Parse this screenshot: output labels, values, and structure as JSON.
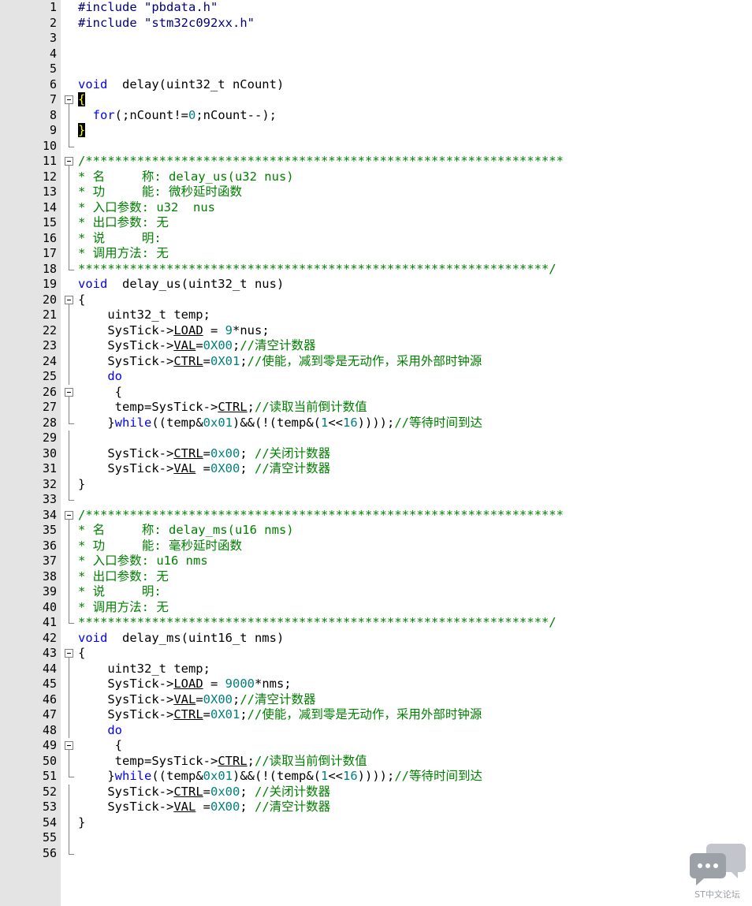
{
  "editor": {
    "lines": [
      {
        "n": "1",
        "fold": "",
        "t": [
          [
            "pp",
            "#include "
          ],
          [
            "str",
            "\"pbdata.h\""
          ]
        ]
      },
      {
        "n": "2",
        "fold": "",
        "t": [
          [
            "pp",
            "#include "
          ],
          [
            "str",
            "\"stm32c092xx.h\""
          ]
        ]
      },
      {
        "n": "3",
        "fold": "",
        "t": []
      },
      {
        "n": "4",
        "fold": "",
        "t": []
      },
      {
        "n": "5",
        "fold": "",
        "t": []
      },
      {
        "n": "6",
        "fold": "",
        "t": [
          [
            "kw",
            "void"
          ],
          [
            "",
            "  delay(uint32_t nCount)"
          ]
        ]
      },
      {
        "n": "7",
        "fold": "box",
        "t": [
          [
            "hl",
            "{"
          ]
        ]
      },
      {
        "n": "8",
        "fold": "line",
        "t": [
          [
            "",
            "  "
          ],
          [
            "kw",
            "for"
          ],
          [
            "",
            "(;nCount!="
          ],
          [
            "num",
            "0"
          ],
          [
            "",
            ";nCount--);"
          ]
        ]
      },
      {
        "n": "9",
        "fold": "line",
        "t": [
          [
            "hl",
            "}"
          ]
        ]
      },
      {
        "n": "10",
        "fold": "end",
        "t": []
      },
      {
        "n": "11",
        "fold": "box",
        "t": [
          [
            "cm",
            "/*****************************************************************"
          ]
        ]
      },
      {
        "n": "12",
        "fold": "line",
        "t": [
          [
            "cm",
            "* 名     称: delay_us(u32 nus)"
          ]
        ]
      },
      {
        "n": "13",
        "fold": "line",
        "t": [
          [
            "cm",
            "* 功     能: 微秒延时函数"
          ]
        ]
      },
      {
        "n": "14",
        "fold": "line",
        "t": [
          [
            "cm",
            "* 入口参数: u32  nus"
          ]
        ]
      },
      {
        "n": "15",
        "fold": "line",
        "t": [
          [
            "cm",
            "* 出口参数: 无"
          ]
        ]
      },
      {
        "n": "16",
        "fold": "line",
        "t": [
          [
            "cm",
            "* 说     明:"
          ]
        ]
      },
      {
        "n": "17",
        "fold": "line",
        "t": [
          [
            "cm",
            "* 调用方法: 无"
          ]
        ]
      },
      {
        "n": "18",
        "fold": "end",
        "t": [
          [
            "cm",
            "****************************************************************/"
          ]
        ]
      },
      {
        "n": "19",
        "fold": "",
        "t": [
          [
            "kw",
            "void"
          ],
          [
            "",
            "  delay_us(uint32_t nus)"
          ]
        ]
      },
      {
        "n": "20",
        "fold": "box",
        "t": [
          [
            "",
            "{"
          ]
        ]
      },
      {
        "n": "21",
        "fold": "line",
        "t": [
          [
            "",
            "    uint32_t temp;"
          ]
        ]
      },
      {
        "n": "22",
        "fold": "line",
        "t": [
          [
            "",
            "    SysTick->"
          ],
          [
            "u",
            "LOAD"
          ],
          [
            "",
            " = "
          ],
          [
            "num",
            "9"
          ],
          [
            "",
            "*nus;"
          ]
        ]
      },
      {
        "n": "23",
        "fold": "line",
        "t": [
          [
            "",
            "    SysTick->"
          ],
          [
            "u",
            "VAL"
          ],
          [
            "",
            "="
          ],
          [
            "num",
            "0X00"
          ],
          [
            "",
            ";"
          ],
          [
            "cm",
            "//清空计数器"
          ]
        ]
      },
      {
        "n": "24",
        "fold": "line",
        "t": [
          [
            "",
            "    SysTick->"
          ],
          [
            "u",
            "CTRL"
          ],
          [
            "",
            "="
          ],
          [
            "num",
            "0X01"
          ],
          [
            "",
            ";"
          ],
          [
            "cm",
            "//使能，减到零是无动作，采用外部时钟源"
          ]
        ]
      },
      {
        "n": "25",
        "fold": "line",
        "t": [
          [
            "",
            "    "
          ],
          [
            "kw",
            "do"
          ]
        ]
      },
      {
        "n": "26",
        "fold": "box",
        "t": [
          [
            "",
            "     {"
          ]
        ]
      },
      {
        "n": "27",
        "fold": "line",
        "t": [
          [
            "",
            "     temp=SysTick->"
          ],
          [
            "u",
            "CTRL"
          ],
          [
            "",
            ";"
          ],
          [
            "cm",
            "//读取当前倒计数值"
          ]
        ]
      },
      {
        "n": "28",
        "fold": "end",
        "t": [
          [
            "",
            "    }"
          ],
          [
            "kw",
            "while"
          ],
          [
            "",
            "((temp&"
          ],
          [
            "num",
            "0x01"
          ],
          [
            "",
            ")&&(!(temp&("
          ],
          [
            "num",
            "1"
          ],
          [
            "",
            "<<"
          ],
          [
            "num",
            "16"
          ],
          [
            "",
            "))));"
          ],
          [
            "cm",
            "//等待时间到达"
          ]
        ]
      },
      {
        "n": "29",
        "fold": "line",
        "t": []
      },
      {
        "n": "30",
        "fold": "line",
        "t": [
          [
            "",
            "    SysTick->"
          ],
          [
            "u",
            "CTRL"
          ],
          [
            "",
            "="
          ],
          [
            "num",
            "0x00"
          ],
          [
            "",
            "; "
          ],
          [
            "cm",
            "//关闭计数器"
          ]
        ]
      },
      {
        "n": "31",
        "fold": "line",
        "t": [
          [
            "",
            "    SysTick->"
          ],
          [
            "u",
            "VAL"
          ],
          [
            "",
            " ="
          ],
          [
            "num",
            "0X00"
          ],
          [
            "",
            "; "
          ],
          [
            "cm",
            "//清空计数器"
          ]
        ]
      },
      {
        "n": "32",
        "fold": "line",
        "t": [
          [
            "",
            "}"
          ]
        ]
      },
      {
        "n": "33",
        "fold": "end",
        "t": []
      },
      {
        "n": "34",
        "fold": "box",
        "t": [
          [
            "cm",
            "/*****************************************************************"
          ]
        ]
      },
      {
        "n": "35",
        "fold": "line",
        "t": [
          [
            "cm",
            "* 名     称: delay_ms(u16 nms)"
          ]
        ]
      },
      {
        "n": "36",
        "fold": "line",
        "t": [
          [
            "cm",
            "* 功     能: 毫秒延时函数"
          ]
        ]
      },
      {
        "n": "37",
        "fold": "line",
        "t": [
          [
            "cm",
            "* 入口参数: u16 nms"
          ]
        ]
      },
      {
        "n": "38",
        "fold": "line",
        "t": [
          [
            "cm",
            "* 出口参数: 无"
          ]
        ]
      },
      {
        "n": "39",
        "fold": "line",
        "t": [
          [
            "cm",
            "* 说     明:"
          ]
        ]
      },
      {
        "n": "40",
        "fold": "line",
        "t": [
          [
            "cm",
            "* 调用方法: 无"
          ]
        ]
      },
      {
        "n": "41",
        "fold": "end",
        "t": [
          [
            "cm",
            "****************************************************************/"
          ]
        ]
      },
      {
        "n": "42",
        "fold": "",
        "t": [
          [
            "kw",
            "void"
          ],
          [
            "",
            "  delay_ms(uint16_t nms)"
          ]
        ]
      },
      {
        "n": "43",
        "fold": "box",
        "t": [
          [
            "",
            "{"
          ]
        ]
      },
      {
        "n": "44",
        "fold": "line",
        "t": [
          [
            "",
            "    uint32_t temp;"
          ]
        ]
      },
      {
        "n": "45",
        "fold": "line",
        "t": [
          [
            "",
            "    SysTick->"
          ],
          [
            "u",
            "LOAD"
          ],
          [
            "",
            " = "
          ],
          [
            "num",
            "9000"
          ],
          [
            "",
            "*nms;"
          ]
        ]
      },
      {
        "n": "46",
        "fold": "line",
        "t": [
          [
            "",
            "    SysTick->"
          ],
          [
            "u",
            "VAL"
          ],
          [
            "",
            "="
          ],
          [
            "num",
            "0X00"
          ],
          [
            "",
            ";"
          ],
          [
            "cm",
            "//清空计数器"
          ]
        ]
      },
      {
        "n": "47",
        "fold": "line",
        "t": [
          [
            "",
            "    SysTick->"
          ],
          [
            "u",
            "CTRL"
          ],
          [
            "",
            "="
          ],
          [
            "num",
            "0X01"
          ],
          [
            "",
            ";"
          ],
          [
            "cm",
            "//使能，减到零是无动作，采用外部时钟源"
          ]
        ]
      },
      {
        "n": "48",
        "fold": "line",
        "t": [
          [
            "",
            "    "
          ],
          [
            "kw",
            "do"
          ]
        ]
      },
      {
        "n": "49",
        "fold": "box",
        "t": [
          [
            "",
            "     {"
          ]
        ]
      },
      {
        "n": "50",
        "fold": "line",
        "t": [
          [
            "",
            "     temp=SysTick->"
          ],
          [
            "u",
            "CTRL"
          ],
          [
            "",
            ";"
          ],
          [
            "cm",
            "//读取当前倒计数值"
          ]
        ]
      },
      {
        "n": "51",
        "fold": "end",
        "t": [
          [
            "",
            "    }"
          ],
          [
            "kw",
            "while"
          ],
          [
            "",
            "((temp&"
          ],
          [
            "num",
            "0x01"
          ],
          [
            "",
            ")&&(!(temp&("
          ],
          [
            "num",
            "1"
          ],
          [
            "",
            "<<"
          ],
          [
            "num",
            "16"
          ],
          [
            "",
            "))));"
          ],
          [
            "cm",
            "//等待时间到达"
          ]
        ]
      },
      {
        "n": "52",
        "fold": "line",
        "t": [
          [
            "",
            "    SysTick->"
          ],
          [
            "u",
            "CTRL"
          ],
          [
            "",
            "="
          ],
          [
            "num",
            "0x00"
          ],
          [
            "",
            "; "
          ],
          [
            "cm",
            "//关闭计数器"
          ]
        ]
      },
      {
        "n": "53",
        "fold": "line",
        "t": [
          [
            "",
            "    SysTick->"
          ],
          [
            "u",
            "VAL"
          ],
          [
            "",
            " ="
          ],
          [
            "num",
            "0X00"
          ],
          [
            "",
            "; "
          ],
          [
            "cm",
            "//清空计数器"
          ]
        ]
      },
      {
        "n": "54",
        "fold": "line",
        "t": [
          [
            "",
            "}"
          ]
        ]
      },
      {
        "n": "55",
        "fold": "line",
        "t": []
      },
      {
        "n": "56",
        "fold": "end",
        "t": []
      }
    ]
  },
  "watermark": {
    "icon": "chat-bubbles-icon",
    "text": "ST中文论坛",
    "color": "#9a9ea4"
  }
}
